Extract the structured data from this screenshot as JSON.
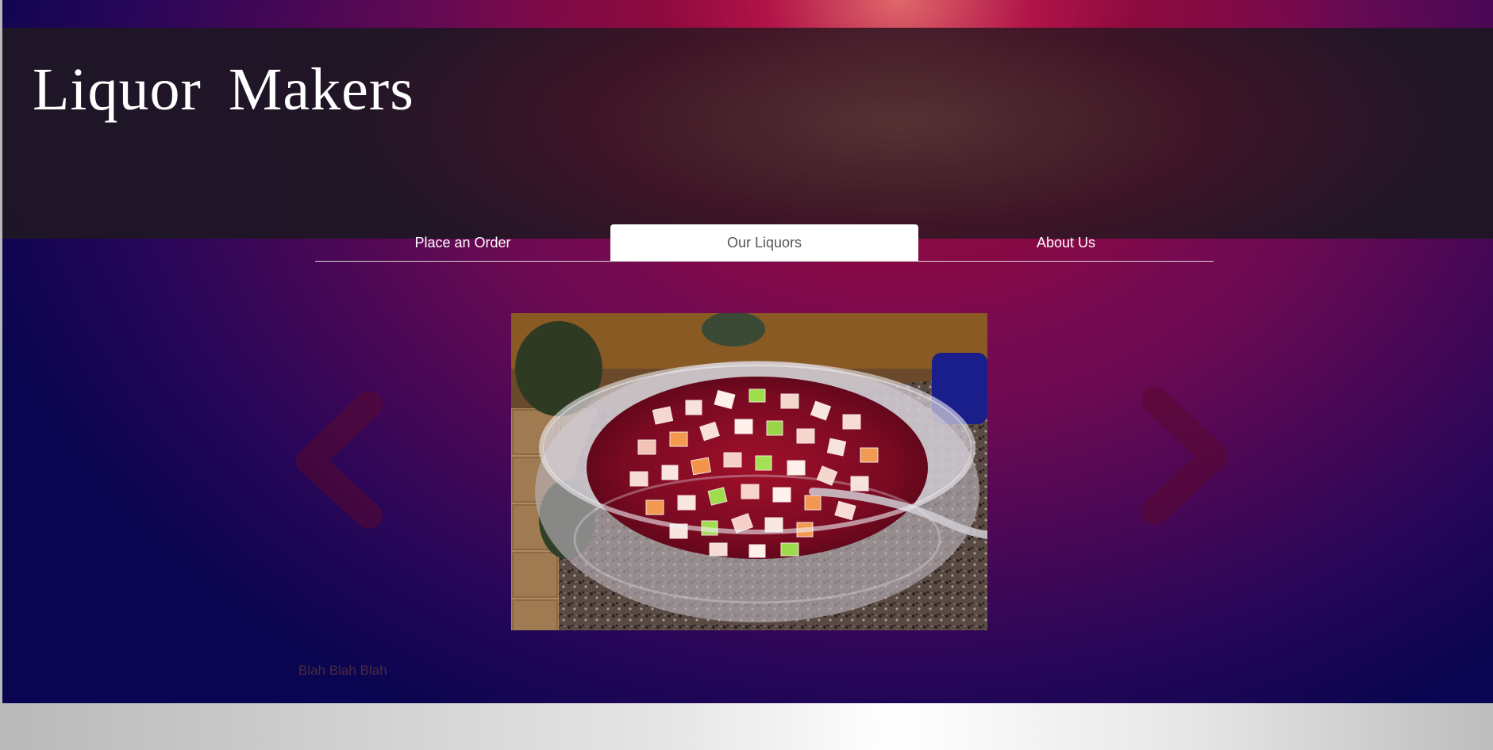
{
  "header": {
    "site_title": "Liquor  Makers"
  },
  "nav": {
    "items": [
      {
        "label": "Place an Order",
        "active": false
      },
      {
        "label": "Our Liquors",
        "active": true
      },
      {
        "label": "About Us",
        "active": false
      }
    ]
  },
  "carousel": {
    "image_subject": "punch-bowl-with-fruit",
    "caption": "Blah Blah Blah",
    "prev_icon": "chevron-left-icon",
    "next_icon": "chevron-right-icon"
  },
  "colors": {
    "background_dark": "#0c0550",
    "background_magenta": "#b01348",
    "header_overlay": "#2e1a26",
    "active_tab": "#ffffff",
    "nav_underline": "#d8d8d8"
  }
}
